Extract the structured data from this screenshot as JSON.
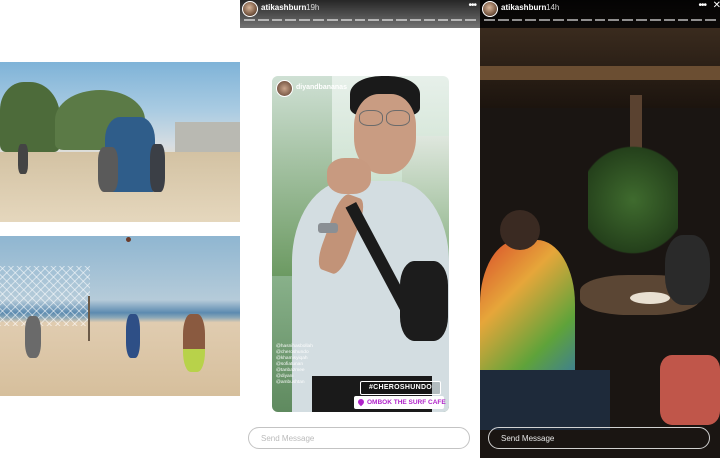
{
  "stories": [
    {
      "username": "atikashburn",
      "timestamp": "19h",
      "progress_segments": 17,
      "reshared_card": {
        "username": "diyandbananas",
        "hashtag": "#CHEROSHUNDO",
        "location": "OMBOK THE SURF CAFE",
        "mentions": [
          "@hasnihasbollah",
          "@cheroshundo",
          "@khamisyiqah",
          "@sofiatunan",
          "@tanbazmee",
          "@diyani",
          "@ambushtan"
        ]
      },
      "send_placeholder": "Send Message"
    },
    {
      "username": "atikashburn",
      "timestamp": "14h",
      "progress_segments": 17,
      "send_placeholder": "Send Message"
    }
  ],
  "icons": {
    "more": "more-horizontal-icon",
    "close": "close-icon",
    "location": "location-pin-icon"
  },
  "colors": {
    "location_accent": "#b023c9",
    "header_text": "#ffffff"
  }
}
